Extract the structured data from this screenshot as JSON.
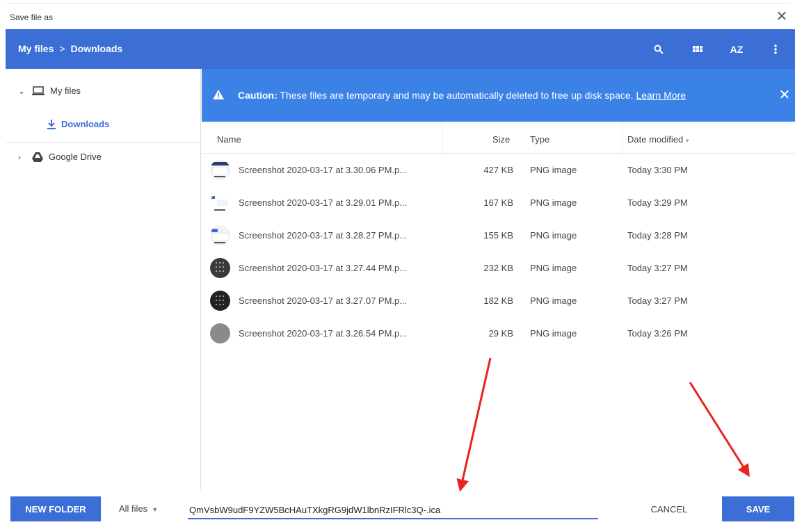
{
  "window": {
    "title": "Save file as"
  },
  "header": {
    "breadcrumb": [
      "My files",
      "Downloads"
    ],
    "breadcrumb_sep": ">",
    "sort_label": "AZ",
    "accent": "#3b6fd6"
  },
  "sidebar": {
    "items": [
      {
        "label": "My files",
        "icon": "laptop-icon",
        "expanded": true
      },
      {
        "label": "Downloads",
        "icon": "download-icon",
        "selected": true
      },
      {
        "label": "Google Drive",
        "icon": "google-drive-icon",
        "expanded": false
      }
    ]
  },
  "banner": {
    "bold": "Caution:",
    "text": " These files are temporary and may be automatically deleted to free up disk space. ",
    "link": "Learn More",
    "color": "#3b82e6"
  },
  "table": {
    "columns": {
      "name": "Name",
      "size": "Size",
      "type": "Type",
      "date": "Date modified"
    },
    "rows": [
      {
        "name": "Screenshot 2020-03-17 at 3.30.06 PM.p...",
        "size": "427 KB",
        "type": "PNG image",
        "date": "Today 3:30 PM"
      },
      {
        "name": "Screenshot 2020-03-17 at 3.29.01 PM.p...",
        "size": "167 KB",
        "type": "PNG image",
        "date": "Today 3:29 PM"
      },
      {
        "name": "Screenshot 2020-03-17 at 3.28.27 PM.p...",
        "size": "155 KB",
        "type": "PNG image",
        "date": "Today 3:28 PM"
      },
      {
        "name": "Screenshot 2020-03-17 at 3.27.44 PM.p...",
        "size": "232 KB",
        "type": "PNG image",
        "date": "Today 3:27 PM"
      },
      {
        "name": "Screenshot 2020-03-17 at 3.27.07 PM.p...",
        "size": "182 KB",
        "type": "PNG image",
        "date": "Today 3:27 PM"
      },
      {
        "name": "Screenshot 2020-03-17 at 3.26.54 PM.p...",
        "size": "29 KB",
        "type": "PNG image",
        "date": "Today 3:26 PM"
      }
    ]
  },
  "footer": {
    "new_folder": "NEW FOLDER",
    "filter": "All files",
    "filename": "QmVsbW9udF9YZW5BcHAuTXkgRG9jdW1lbnRzIFRlc3Q-.ica",
    "cancel": "CANCEL",
    "save": "SAVE"
  }
}
